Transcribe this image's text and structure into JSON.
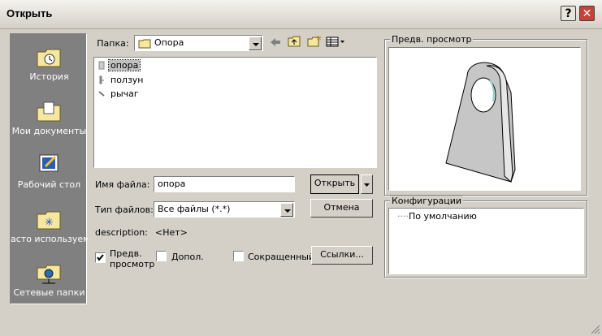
{
  "window": {
    "title": "Открыть",
    "help_glyph": "?",
    "close_glyph": "✕"
  },
  "places": [
    {
      "label": "История",
      "icon": "history-folder-icon"
    },
    {
      "label": "Мои документы",
      "icon": "my-documents-folder-icon"
    },
    {
      "label": "Рабочий стол",
      "icon": "desktop-icon"
    },
    {
      "label": "асто используемь",
      "icon": "favorites-folder-icon"
    },
    {
      "label": "Сетевые папки",
      "icon": "network-folder-icon"
    }
  ],
  "folder": {
    "label": "Папка:",
    "value": "Опора"
  },
  "files": [
    {
      "name": "опора",
      "selected": true
    },
    {
      "name": "ползун",
      "selected": false
    },
    {
      "name": "рычаг",
      "selected": false
    }
  ],
  "filename": {
    "label": "Имя файла:",
    "value": "опора"
  },
  "filetype": {
    "label": "Тип файлов:",
    "value": "Все файлы (*.*)"
  },
  "buttons": {
    "open": "Открыть",
    "cancel": "Отмена",
    "links": "Ссылки..."
  },
  "description": {
    "label": "description:",
    "value": "<Нет>"
  },
  "options": {
    "preview_line1": "Предв.",
    "preview_line2": "просмотр",
    "preview_checked": true,
    "extra": "Допол.",
    "extra_checked": false,
    "reduced": "Сокращенный",
    "reduced_checked": false
  },
  "preview": {
    "label": "Предв. просмотр"
  },
  "configurations": {
    "label": "Конфигурации",
    "items": [
      "По умолчанию"
    ]
  },
  "colors": {
    "places_bg": "#808080",
    "selection": "#c0c0c0",
    "dialog_bg": "#d4d0c8",
    "close_button": "#c8423a"
  }
}
